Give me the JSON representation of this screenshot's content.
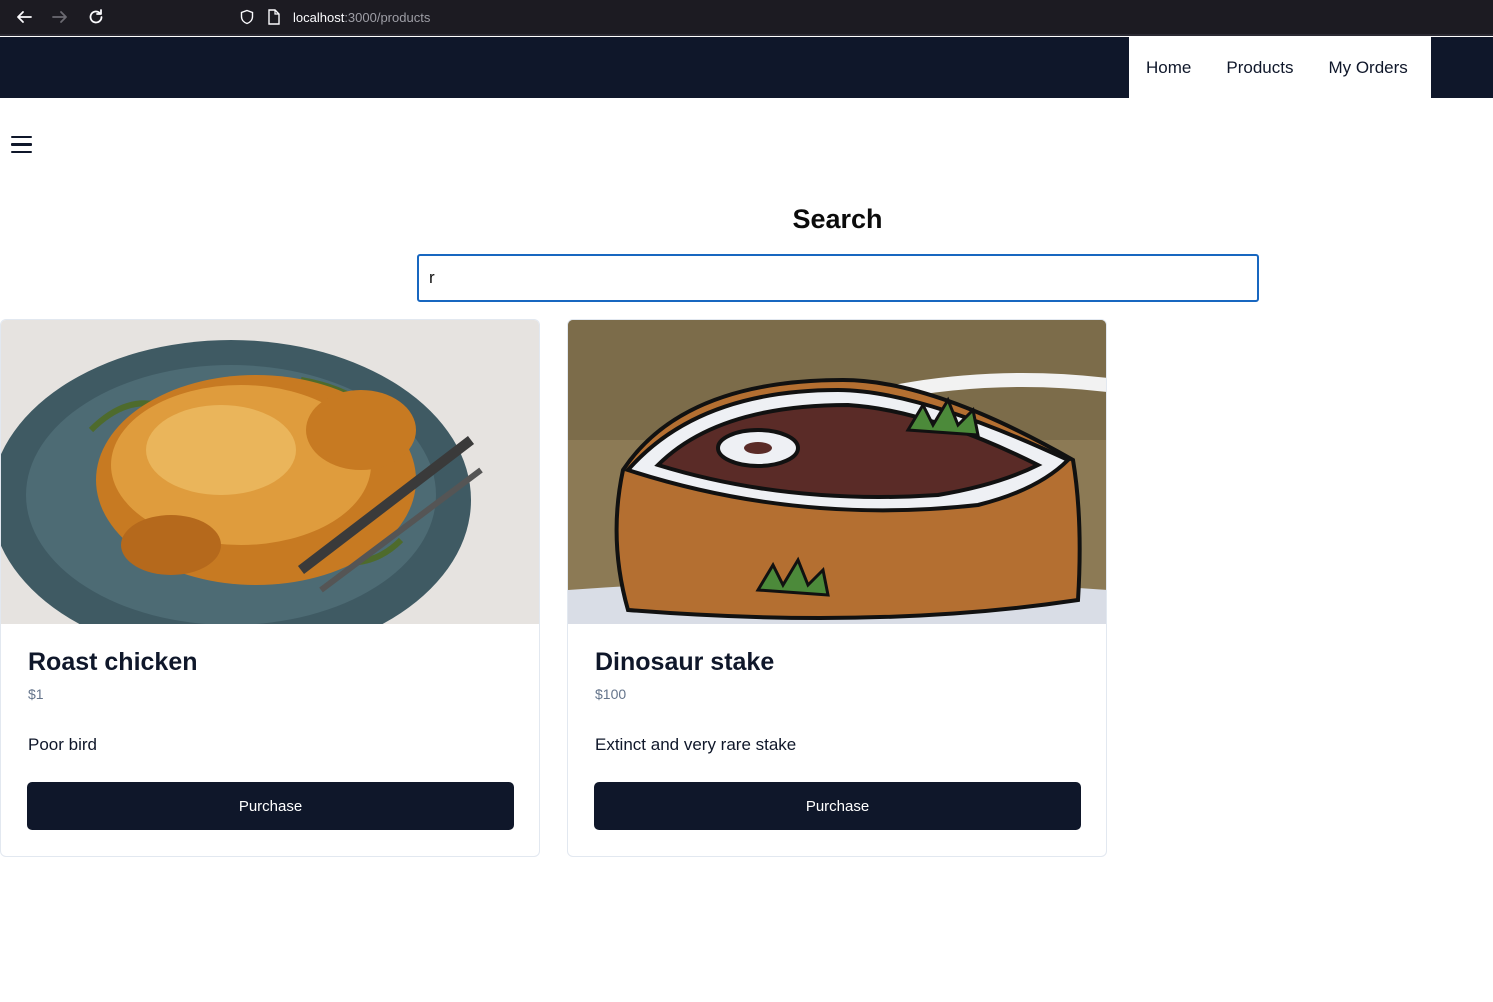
{
  "browser": {
    "url_host": "localhost",
    "url_path": ":3000/products",
    "icons": [
      "back-icon",
      "forward-icon",
      "reload-icon",
      "shield-icon",
      "page-icon"
    ]
  },
  "nav": {
    "items": [
      {
        "label": "Home"
      },
      {
        "label": "Products"
      },
      {
        "label": "My Orders"
      }
    ]
  },
  "search": {
    "title": "Search",
    "value": "r"
  },
  "products": [
    {
      "name": "Roast chicken",
      "price": "$1",
      "description": "Poor bird",
      "button": "Purchase",
      "image": "roast-chicken-image"
    },
    {
      "name": "Dinosaur stake",
      "price": "$100",
      "description": "Extinct and very rare stake",
      "button": "Purchase",
      "image": "dinosaur-steak-image"
    }
  ],
  "colors": {
    "header_bg": "#0f172a",
    "button_bg": "#0f172a",
    "input_border": "#1867c0",
    "price_text": "#64748b"
  }
}
